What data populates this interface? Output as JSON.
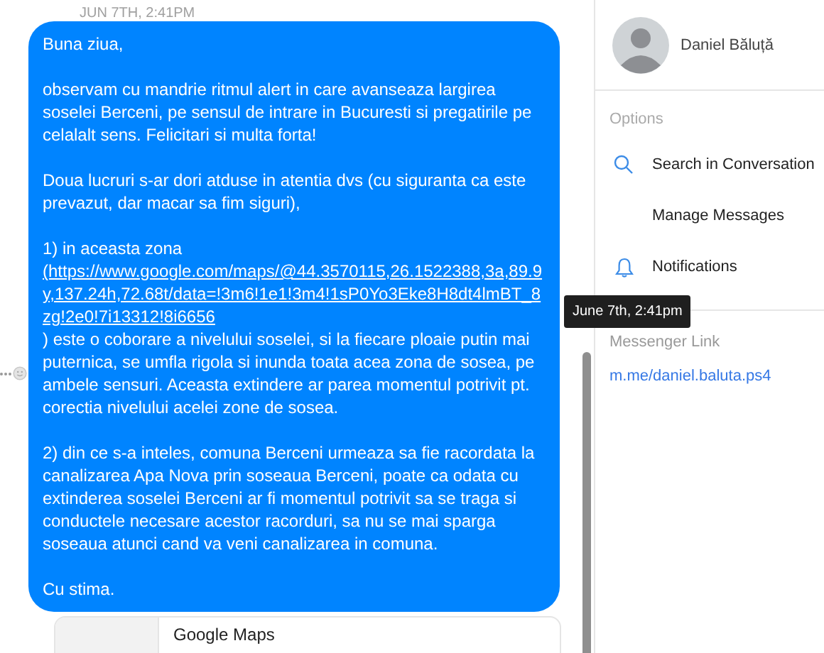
{
  "date_header": "JUN 7TH, 2:41PM",
  "message": {
    "paragraphs": [
      [
        {
          "kind": "text",
          "text": "Buna ziua,"
        }
      ],
      [
        {
          "kind": "text",
          "text": "observam cu mandrie ritmul alert in care avanseaza largirea soselei Berceni, pe sensul de intrare in Bucuresti si pregatirile pe celalalt sens. Felicitari si multa forta!"
        }
      ],
      [
        {
          "kind": "text",
          "text": "Doua lucruri s-ar dori atduse in atentia dvs (cu siguranta ca este prevazut, dar macar sa fim siguri),"
        }
      ],
      [
        {
          "kind": "text",
          "text": "1) in aceasta zona "
        },
        {
          "kind": "link",
          "text": "(https://www.google.com/maps/@44.3570115,26.1522388,3a,89.9y,137.24h,72.68t/data=!3m6!1e1!3m4!1sP0Yo3Eke8H8dt4lmBT_8zg!2e0!7i13312!8i6656"
        },
        {
          "kind": "text",
          "text": ") este o coborare a nivelului soselei, si la fiecare ploaie putin mai puternica, se umfla rigola si inunda toata acea zona de sosea, pe ambele sensuri. Aceasta extindere ar parea momentul potrivit pt. corectia nivelului acelei zone de sosea."
        }
      ],
      [
        {
          "kind": "text",
          "text": "2) din ce s-a inteles, comuna Berceni urmeaza sa fie racordata la canalizarea Apa Nova prin soseaua Berceni, poate ca odata cu extinderea soselei Berceni ar fi momentul potrivit sa se traga si conductele necesare acestor racorduri, sa nu se mai sparga soseaua atunci cand va veni canalizarea in comuna."
        }
      ],
      [
        {
          "kind": "text",
          "text": "Cu stima."
        }
      ]
    ]
  },
  "link_preview": {
    "title": "Google Maps"
  },
  "tooltip": "June 7th, 2:41pm",
  "profile": {
    "name": "Daniel Băluță"
  },
  "options": {
    "heading": "Options",
    "items": [
      {
        "label": "Search in Conversation",
        "kind": "search"
      },
      {
        "label": "Manage Messages",
        "kind": "plain"
      },
      {
        "label": "Notifications",
        "kind": "alerts"
      }
    ]
  },
  "messenger_link": {
    "heading": "Messenger Link",
    "url": "m.me/daniel.baluta.ps4"
  }
}
